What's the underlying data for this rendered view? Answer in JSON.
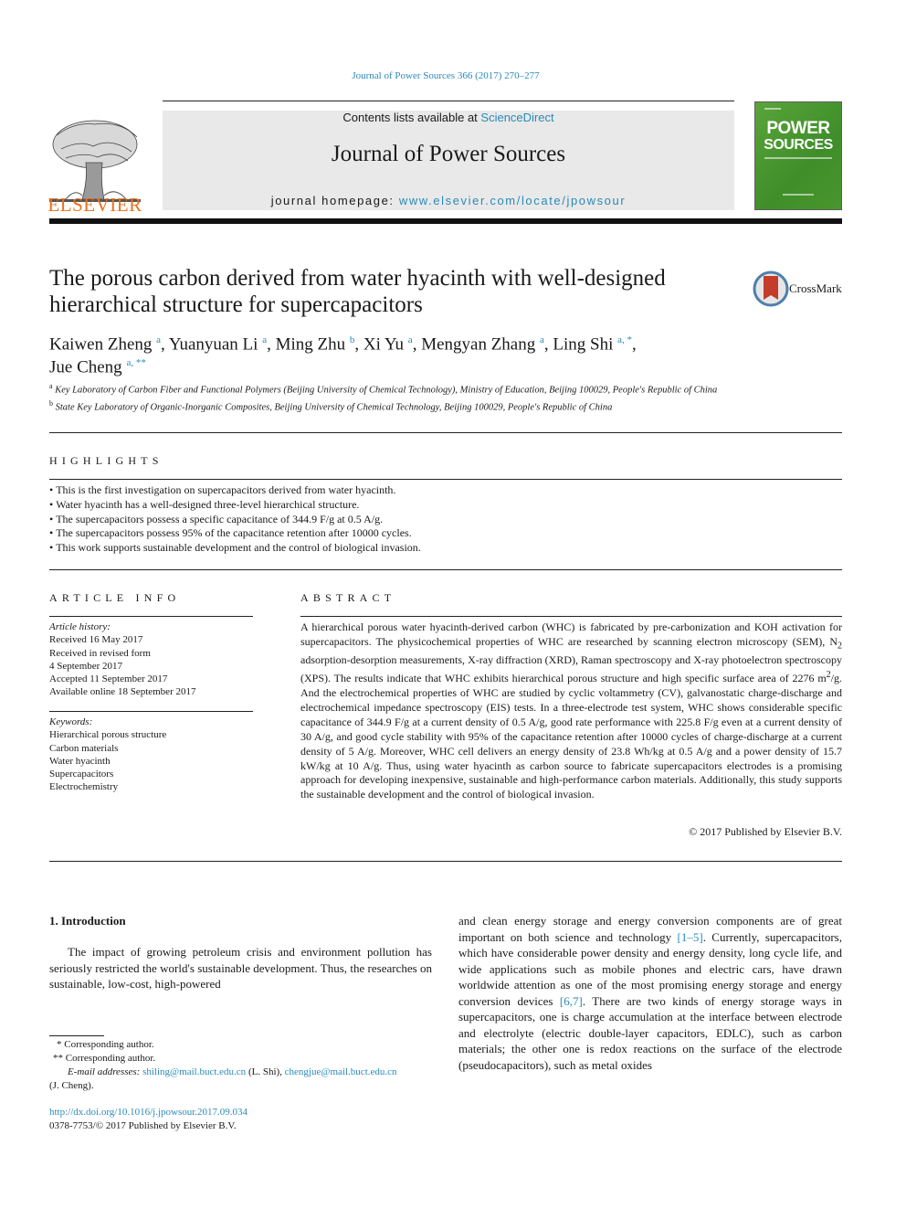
{
  "header": {
    "journal_ref": "Journal of Power Sources 366 (2017) 270–277",
    "contents_prefix": "Contents lists available at ",
    "contents_link": "ScienceDirect",
    "journal_title": "Journal of Power Sources",
    "homepage_prefix": "journal homepage: ",
    "homepage_link": "www.elsevier.com/locate/jpowsour",
    "publisher_wordmark": "ELSEVIER",
    "cover_title_line1": "POWER",
    "cover_title_line2": "SOURCES",
    "brand_color": "#e9711c",
    "link_color": "#2a8ab8",
    "cover_color": "#4a962d"
  },
  "article": {
    "title": "The porous carbon derived from water hyacinth with well-designed hierarchical structure for supercapacitors",
    "crossmark_label": "CrossMark",
    "authors": [
      {
        "name": "Kaiwen Zheng",
        "sup": "a",
        "sep": ", "
      },
      {
        "name": "Yuanyuan Li",
        "sup": "a",
        "sep": ", "
      },
      {
        "name": "Ming Zhu",
        "sup": "b",
        "sep": ", "
      },
      {
        "name": "Xi Yu",
        "sup": "a",
        "sep": ", "
      },
      {
        "name": "Mengyan Zhang",
        "sup": "a",
        "sep": ", "
      },
      {
        "name": "Ling Shi",
        "sup": "a, *",
        "sep": ","
      },
      {
        "name": "Jue Cheng",
        "sup": "a, **",
        "sep": ""
      }
    ],
    "affiliations": [
      {
        "key": "a",
        "text": "Key Laboratory of Carbon Fiber and Functional Polymers (Beijing University of Chemical Technology), Ministry of Education, Beijing 100029, People's Republic of China"
      },
      {
        "key": "b",
        "text": "State Key Laboratory of Organic-Inorganic Composites, Beijing University of Chemical Technology, Beijing 100029, People's Republic of China"
      }
    ]
  },
  "highlights": {
    "label": "HIGHLIGHTS",
    "items": [
      "This is the first investigation on supercapacitors derived from water hyacinth.",
      "Water hyacinth has a well-designed three-level hierarchical structure.",
      "The supercapacitors possess a specific capacitance of 344.9 F/g at 0.5 A/g.",
      "The supercapacitors possess 95% of the capacitance retention after 10000 cycles.",
      "This work supports sustainable development and the control of biological invasion."
    ]
  },
  "article_info": {
    "label": "ARTICLE INFO",
    "history_label": "Article history:",
    "history": [
      "Received 16 May 2017",
      "Received in revised form",
      "4 September 2017",
      "Accepted 11 September 2017",
      "Available online 18 September 2017"
    ],
    "keywords_label": "Keywords:",
    "keywords": [
      "Hierarchical porous structure",
      "Carbon materials",
      "Water hyacinth",
      "Supercapacitors",
      "Electrochemistry"
    ]
  },
  "abstract": {
    "label": "ABSTRACT",
    "part1": "A hierarchical porous water hyacinth-derived carbon (WHC) is fabricated by pre-carbonization and KOH activation for supercapacitors. The physicochemical properties of WHC are researched by scanning electron microscopy (SEM), N",
    "sub": "2",
    "part2": " adsorption-desorption measurements, X-ray diffraction (XRD), Raman spectroscopy and X-ray photoelectron spectroscopy (XPS). The results indicate that WHC exhibits hierarchical porous structure and high specific surface area of 2276 m",
    "sup": "2",
    "part3": "/g. And the electrochemical properties of WHC are studied by cyclic voltammetry (CV), galvanostatic charge-discharge and electrochemical impedance spectroscopy (EIS) tests. In a three-electrode test system, WHC shows considerable specific capacitance of 344.9 F/g at a current density of 0.5 A/g, good rate performance with 225.8 F/g even at a current density of 30 A/g, and good cycle stability with 95% of the capacitance retention after 10000 cycles of charge-discharge at a current density of 5 A/g. Moreover, WHC cell delivers an energy density of 23.8 Wh/kg at 0.5 A/g and a power density of 15.7 kW/kg at 10 A/g. Thus, using water hyacinth as carbon source to fabricate supercapacitors electrodes is a promising approach for developing inexpensive, sustainable and high-performance carbon materials. Additionally, this study supports the sustainable development and the control of biological invasion.",
    "copyright": "© 2017 Published by Elsevier B.V."
  },
  "introduction": {
    "heading": "1.  Introduction",
    "col1": "The impact of growing petroleum crisis and environment pollution has seriously restricted the world's sustainable development. Thus, the researches on sustainable, low-cost, high-powered",
    "col2_a": "and clean energy storage and energy conversion components are of great important on both science and technology ",
    "ref1": "[1–5]",
    "col2_b": ". Currently, supercapacitors, which have considerable power density and energy density, long cycle life, and wide applications such as mobile phones and electric cars, have drawn worldwide attention as one of the most promising energy storage and energy conversion devices ",
    "ref2": "[6,7]",
    "col2_c": ". There are two kinds of energy storage ways in supercapacitors, one is charge accumulation at the interface between electrode and electrolyte (electric double-layer capacitors, EDLC), such as carbon materials; the other one is redox reactions on the surface of the electrode (pseudocapacitors), such as metal oxides"
  },
  "footnotes": {
    "star1": "*  Corresponding author.",
    "star2": "**  Corresponding author.",
    "email_label": "E-mail addresses:",
    "email1": "shiling@mail.buct.edu.cn",
    "email1_owner": " (L. Shi), ",
    "email2": "chengjue@mail.buct.edu.cn",
    "email2_owner": "(J. Cheng).",
    "doi": "http://dx.doi.org/10.1016/j.jpowsour.2017.09.034",
    "issn": "0378-7753/© 2017 Published by Elsevier B.V."
  }
}
